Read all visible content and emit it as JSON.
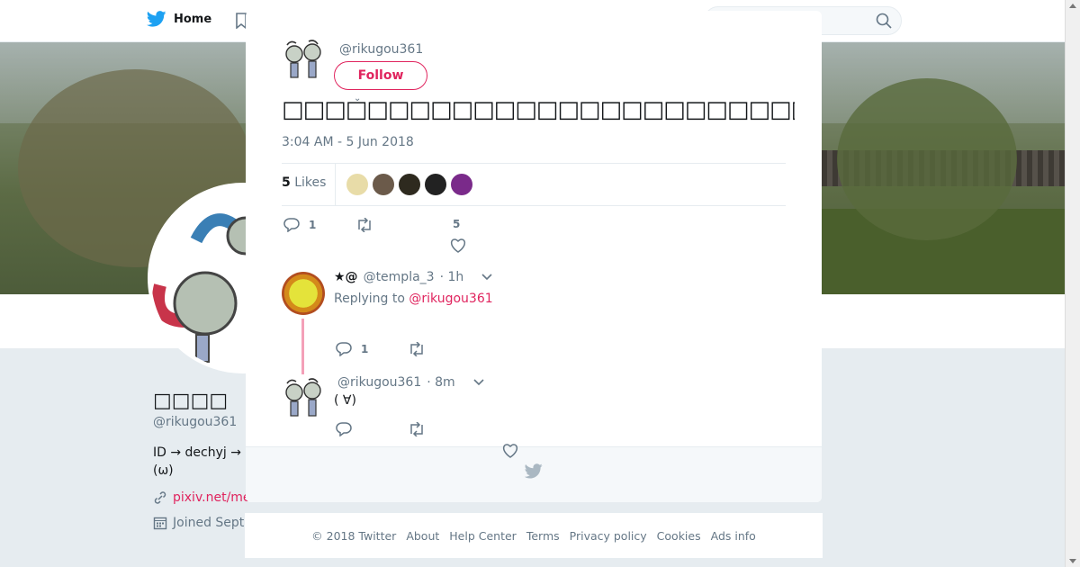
{
  "nav": {
    "home_label": "Home"
  },
  "profile": {
    "name": "□□□□",
    "handle": "@rikugou361",
    "bio": "ID → dechyj  → (ω)",
    "link": "pixiv.net/me",
    "joined": "Joined Sept"
  },
  "tweet": {
    "author_handle": "@rikugou361",
    "follow_label": "Follow",
    "text": "□□□□□□□□□□□□□□□□□□□□□□□□□□□□□□□□□□",
    "timestamp": "3:04 AM - 5 Jun 2018",
    "likes_count": "5",
    "likes_label": "Likes",
    "reply_count": "1",
    "like_count": "5",
    "liker_colors": [
      "#e8dca8",
      "#6b5a4a",
      "#2e2a1f",
      "#222222",
      "#7a2a8a"
    ]
  },
  "replies": [
    {
      "name": "★@",
      "handle": "@templa_3",
      "time": "· 1h",
      "replying_prefix": "Replying to",
      "replying_to": "@rikugou361",
      "reply_count": "1"
    },
    {
      "handle": "@rikugou361",
      "time": "· 8m",
      "text": "( ∀)"
    }
  ],
  "footer": {
    "links": [
      "© 2018 Twitter",
      "About",
      "Help Center",
      "Terms",
      "Privacy policy",
      "Cookies",
      "Ads info"
    ]
  },
  "colors": {
    "accent": "#e0245e",
    "muted": "#657786",
    "brand": "#1da1f2"
  }
}
